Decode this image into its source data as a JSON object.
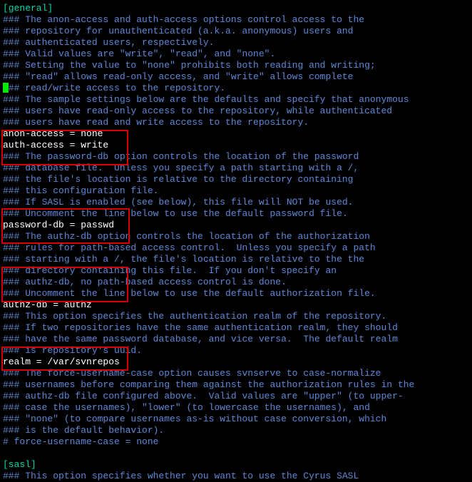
{
  "colors": {
    "comment": "#5f87d7",
    "section": "#00d7af",
    "setting": "#ffffff",
    "highlight_border": "#d70000",
    "cursor": "#00ff00",
    "background": "#000000"
  },
  "cursor": {
    "line_index": 7
  },
  "highlights": [
    {
      "box": 1,
      "from_line": 11,
      "to_line": 13
    },
    {
      "box": 2,
      "from_line": 18,
      "to_line": 20
    },
    {
      "box": 3,
      "from_line": 23,
      "to_line": 25
    },
    {
      "box": 4,
      "from_line": 30,
      "to_line": 31
    }
  ],
  "lines": [
    {
      "kind": "section",
      "text": "[general]"
    },
    {
      "kind": "comment",
      "text": "### The anon-access and auth-access options control access to the"
    },
    {
      "kind": "comment",
      "text": "### repository for unauthenticated (a.k.a. anonymous) users and"
    },
    {
      "kind": "comment",
      "text": "### authenticated users, respectively."
    },
    {
      "kind": "comment",
      "text": "### Valid values are \"write\", \"read\", and \"none\"."
    },
    {
      "kind": "comment",
      "text": "### Setting the value to \"none\" prohibits both reading and writing;"
    },
    {
      "kind": "comment",
      "text": "### \"read\" allows read-only access, and \"write\" allows complete"
    },
    {
      "kind": "comment",
      "text": "### read/write access to the repository."
    },
    {
      "kind": "comment",
      "text": "### The sample settings below are the defaults and specify that anonymous"
    },
    {
      "kind": "comment",
      "text": "### users have read-only access to the repository, while authenticated"
    },
    {
      "kind": "comment",
      "text": "### users have read and write access to the repository."
    },
    {
      "kind": "setting",
      "text": "anon-access = none"
    },
    {
      "kind": "setting",
      "text": "auth-access = write"
    },
    {
      "kind": "comment",
      "text": "### The password-db option controls the location of the password"
    },
    {
      "kind": "comment",
      "text": "### database file.  Unless you specify a path starting with a /,"
    },
    {
      "kind": "comment",
      "text": "### the file's location is relative to the directory containing"
    },
    {
      "kind": "comment",
      "text": "### this configuration file."
    },
    {
      "kind": "comment",
      "text": "### If SASL is enabled (see below), this file will NOT be used."
    },
    {
      "kind": "comment",
      "text": "### Uncomment the line below to use the default password file."
    },
    {
      "kind": "setting",
      "text": "password-db = passwd"
    },
    {
      "kind": "comment",
      "text": "### The authz-db option controls the location of the authorization"
    },
    {
      "kind": "comment",
      "text": "### rules for path-based access control.  Unless you specify a path"
    },
    {
      "kind": "comment",
      "text": "### starting with a /, the file's location is relative to the the"
    },
    {
      "kind": "comment",
      "text": "### directory containing this file.  If you don't specify an"
    },
    {
      "kind": "comment",
      "text": "### authz-db, no path-based access control is done."
    },
    {
      "kind": "comment",
      "text": "### Uncomment the line below to use the default authorization file."
    },
    {
      "kind": "setting",
      "text": "authz-db = authz"
    },
    {
      "kind": "comment",
      "text": "### This option specifies the authentication realm of the repository."
    },
    {
      "kind": "comment",
      "text": "### If two repositories have the same authentication realm, they should"
    },
    {
      "kind": "comment",
      "text": "### have the same password database, and vice versa.  The default realm"
    },
    {
      "kind": "comment",
      "text": "### is repository's uuid."
    },
    {
      "kind": "setting",
      "text": "realm = /var/svnrepos"
    },
    {
      "kind": "comment",
      "text": "### The force-username-case option causes svnserve to case-normalize"
    },
    {
      "kind": "comment",
      "text": "### usernames before comparing them against the authorization rules in the"
    },
    {
      "kind": "comment",
      "text": "### authz-db file configured above.  Valid values are \"upper\" (to upper-"
    },
    {
      "kind": "comment",
      "text": "### case the usernames), \"lower\" (to lowercase the usernames), and"
    },
    {
      "kind": "comment",
      "text": "### \"none\" (to compare usernames as-is without case conversion, which"
    },
    {
      "kind": "comment",
      "text": "### is the default behavior)."
    },
    {
      "kind": "comment",
      "text": "# force-username-case = none"
    },
    {
      "kind": "blank",
      "text": ""
    },
    {
      "kind": "section",
      "text": "[sasl]"
    },
    {
      "kind": "comment",
      "text": "### This option specifies whether you want to use the Cyrus SASL"
    }
  ]
}
